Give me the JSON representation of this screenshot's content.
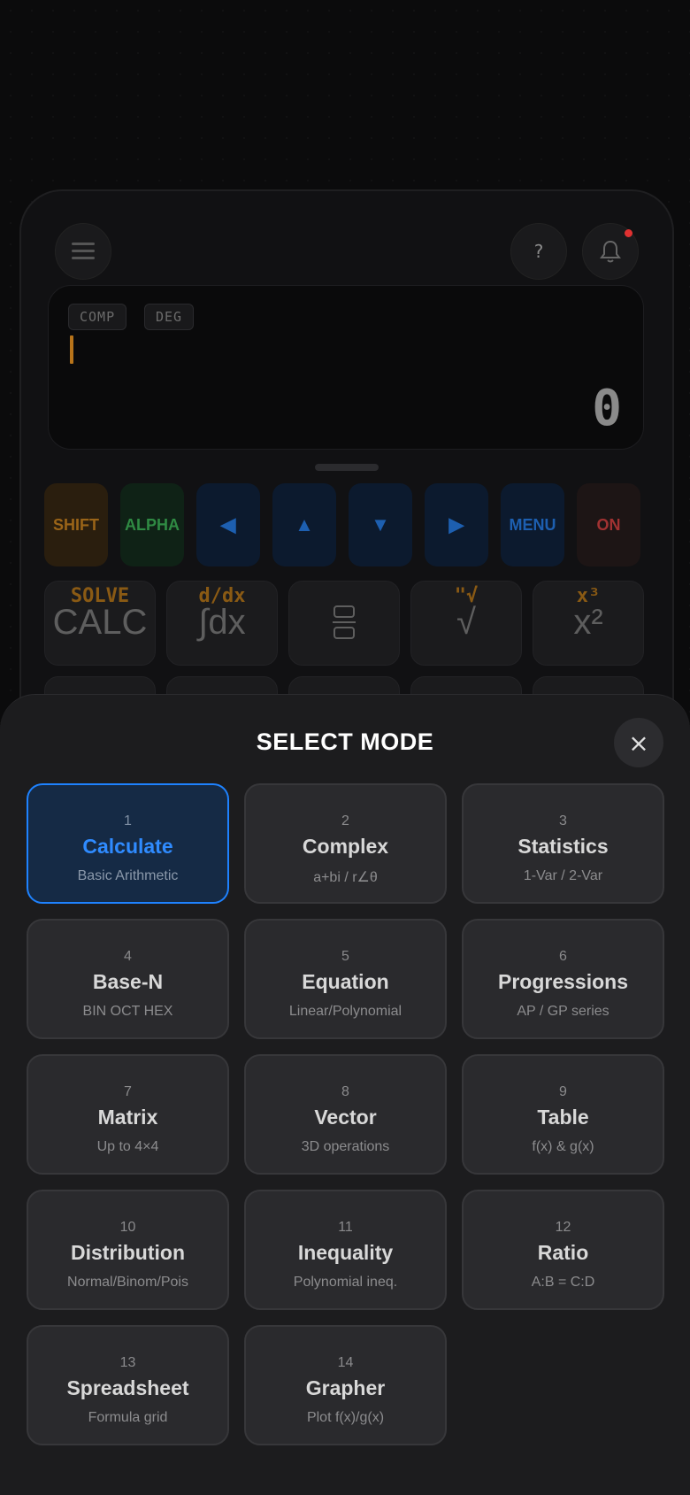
{
  "display": {
    "tags": [
      "COMP",
      "DEG"
    ],
    "value": "0"
  },
  "keys": {
    "shift": "SHIFT",
    "alpha": "ALPHA",
    "left": "◀",
    "up": "▲",
    "down": "▼",
    "right": "▶",
    "menu": "MENU",
    "on": "ON"
  },
  "function_keys": [
    {
      "shift": "SOLVE",
      "main": "CALC"
    },
    {
      "shift": "d/dx",
      "main": "∫dx"
    },
    {
      "shift": "",
      "main": ""
    },
    {
      "shift": "\"√",
      "main": "√"
    },
    {
      "shift": "x³",
      "main": "x²"
    }
  ],
  "sheet": {
    "title": "SELECT MODE",
    "close_icon": "×",
    "selected_index": 0,
    "modes": [
      {
        "num": "1",
        "name": "Calculate",
        "sub": "Basic Arithmetic"
      },
      {
        "num": "2",
        "name": "Complex",
        "sub": "a+bi / r∠θ"
      },
      {
        "num": "3",
        "name": "Statistics",
        "sub": "1-Var / 2-Var"
      },
      {
        "num": "4",
        "name": "Base-N",
        "sub": "BIN OCT HEX"
      },
      {
        "num": "5",
        "name": "Equation",
        "sub": "Linear/Polynomial"
      },
      {
        "num": "6",
        "name": "Progressions",
        "sub": "AP / GP series"
      },
      {
        "num": "7",
        "name": "Matrix",
        "sub": "Up to 4×4"
      },
      {
        "num": "8",
        "name": "Vector",
        "sub": "3D operations"
      },
      {
        "num": "9",
        "name": "Table",
        "sub": "f(x) & g(x)"
      },
      {
        "num": "10",
        "name": "Distribution",
        "sub": "Normal/Binom/Pois"
      },
      {
        "num": "11",
        "name": "Inequality",
        "sub": "Polynomial ineq."
      },
      {
        "num": "12",
        "name": "Ratio",
        "sub": "A:B = C:D"
      },
      {
        "num": "13",
        "name": "Spreadsheet",
        "sub": "Formula grid"
      },
      {
        "num": "14",
        "name": "Grapher",
        "sub": "Plot f(x)/g(x)"
      }
    ]
  },
  "colors": {
    "accent": "#1e82ff",
    "shift": "#9a6418",
    "alpha": "#2f8a43",
    "on": "#a13232"
  }
}
